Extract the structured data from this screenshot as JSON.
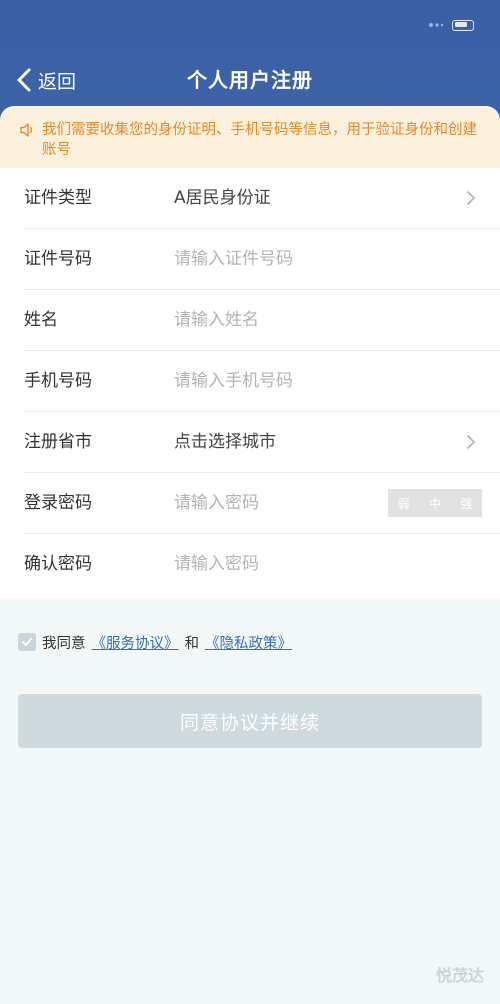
{
  "header": {
    "back_label": "返回",
    "title": "个人用户注册"
  },
  "notice": {
    "text": "我们需要收集您的身份证明、手机号码等信息，用于验证身份和创建账号"
  },
  "form": {
    "rows": [
      {
        "label": "证件类型",
        "value": "A居民身份证"
      },
      {
        "label": "证件号码",
        "placeholder": "请输入证件号码"
      },
      {
        "label": "姓名",
        "placeholder": "请输入姓名"
      },
      {
        "label": "手机号码",
        "placeholder": "请输入手机号码"
      },
      {
        "label": "注册省市",
        "value": "点击选择城市"
      },
      {
        "label": "登录密码",
        "placeholder": "请输入密码"
      },
      {
        "label": "确认密码",
        "placeholder": "请输入密码"
      }
    ],
    "strength": {
      "weak": "弱",
      "medium": "中",
      "strong": "强"
    }
  },
  "agreement": {
    "prefix": "我同意",
    "service_link": "《服务协议》",
    "and": "和",
    "privacy_link": "《隐私政策》"
  },
  "submit_label": "同意协议并继续",
  "watermark": "悦茂达",
  "colors": {
    "header_bg": "#3a5fa4",
    "notice_bg": "#fbf1dc",
    "notice_text": "#e58a2c",
    "link": "#3a6fb8",
    "button_disabled": "#cfdadf"
  }
}
